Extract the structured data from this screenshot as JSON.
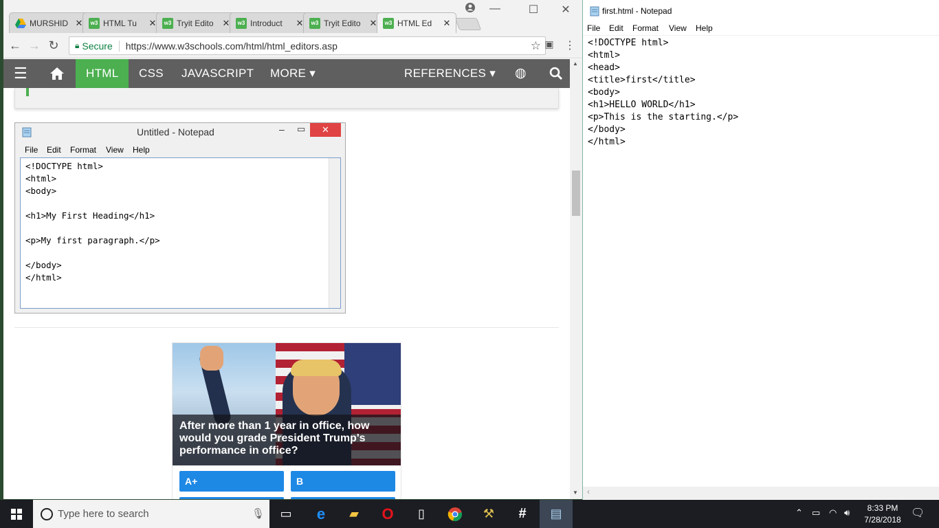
{
  "browser": {
    "tabs": [
      {
        "label": "MURSHID",
        "icon": "drive-icon"
      },
      {
        "label": "HTML Tu",
        "icon": "w3-icon"
      },
      {
        "label": "Tryit Edito",
        "icon": "w3-icon"
      },
      {
        "label": "Introduct",
        "icon": "w3-icon"
      },
      {
        "label": "Tryit Edito",
        "icon": "w3-icon"
      },
      {
        "label": "HTML Ed",
        "icon": "w3-icon"
      }
    ],
    "secure_label": "Secure",
    "url": "https://www.w3schools.com/html/html_editors.asp",
    "nav": {
      "html": "HTML",
      "css": "CSS",
      "javascript": "JAVASCRIPT",
      "more": "MORE ▾",
      "references": "REFERENCES ▾"
    }
  },
  "embedded_notepad": {
    "title": "Untitled - Notepad",
    "menu": [
      "File",
      "Edit",
      "Format",
      "View",
      "Help"
    ],
    "content": "<!DOCTYPE html>\n<html>\n<body>\n\n<h1>My First Heading</h1>\n\n<p>My first paragraph.</p>\n\n</body>\n</html>"
  },
  "ad": {
    "question": "After more than 1 year in office, how would you grade President Trump's performance in office?",
    "options": [
      "A+",
      "B"
    ]
  },
  "notepad": {
    "title": "first.html - Notepad",
    "menu": [
      "File",
      "Edit",
      "Format",
      "View",
      "Help"
    ],
    "content": "<!DOCTYPE html>\n<html>\n<head>\n<title>first</title>\n<body>\n<h1>HELLO WORLD</h1>\n<p>This is the starting.</p>\n</body>\n</html>"
  },
  "taskbar": {
    "search_placeholder": "Type here to search",
    "time": "8:33 PM",
    "date": "7/28/2018"
  },
  "colors": {
    "w3_green": "#4caf50",
    "w3_nav": "#5f5f5f",
    "ad_button": "#1e88e5",
    "taskbar": "#1c1d22"
  }
}
